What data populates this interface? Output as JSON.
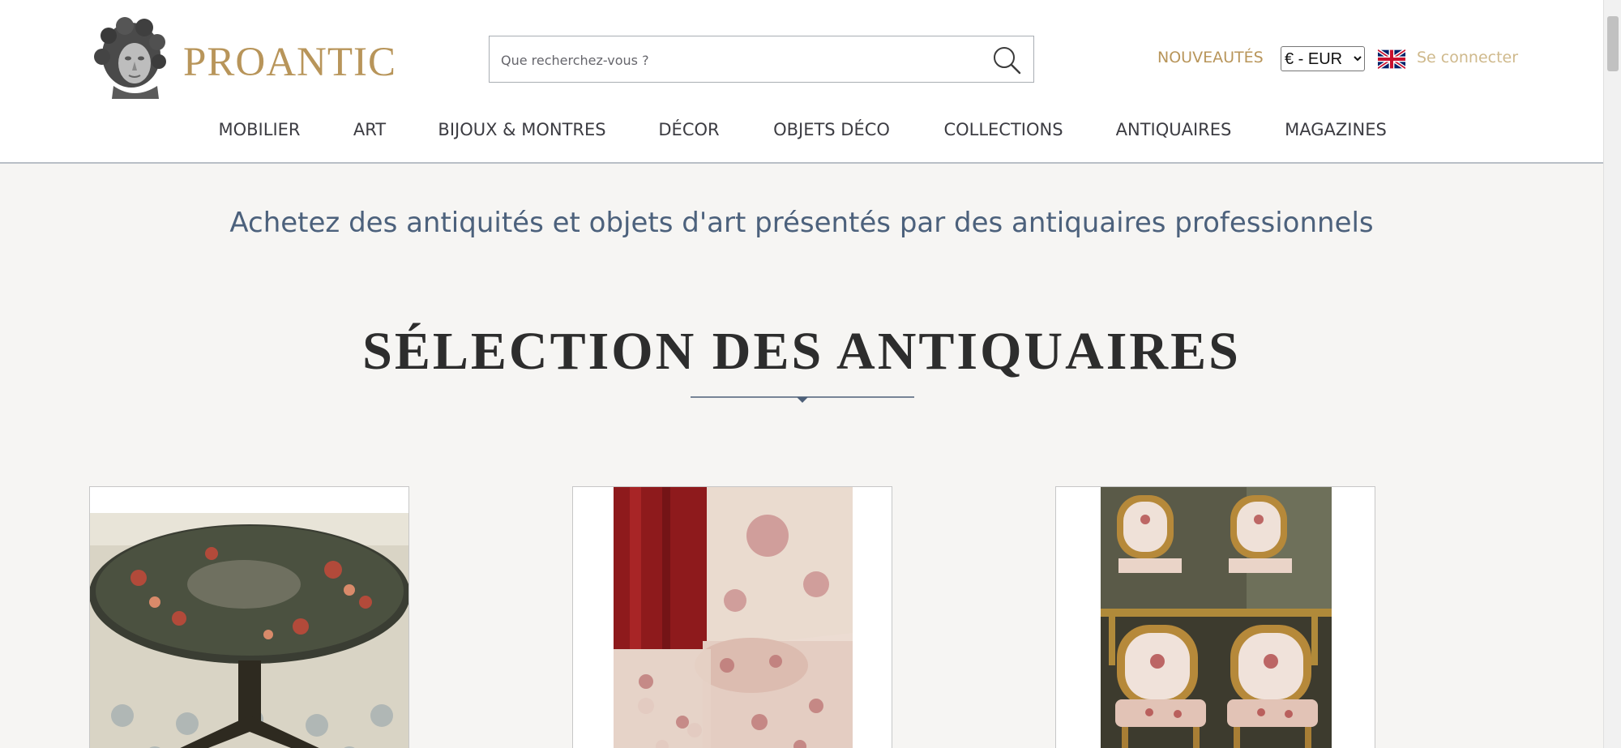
{
  "header": {
    "logo_text": "PROANTIC",
    "search": {
      "placeholder": "Que recherchez-vous ?",
      "value": "",
      "icon": "search-icon"
    },
    "new_label": "NOUVEAUTÉS",
    "currency": {
      "selected": "€ - EUR",
      "options": [
        "€ - EUR"
      ]
    },
    "language_flag": "uk-flag-icon",
    "login_label": "Se connecter"
  },
  "nav": {
    "items": [
      {
        "label": "MOBILIER"
      },
      {
        "label": "ART"
      },
      {
        "label": "BIJOUX & MONTRES"
      },
      {
        "label": "DÉCOR"
      },
      {
        "label": "OBJETS DÉCO"
      },
      {
        "label": "COLLECTIONS"
      },
      {
        "label": "ANTIQUAIRES"
      },
      {
        "label": "MAGAZINES"
      }
    ]
  },
  "main": {
    "tagline": "Achetez des antiquités et objets d'art présentés par des antiquaires professionnels",
    "section_title": "SÉLECTION DES ANTIQUAIRES"
  },
  "colors": {
    "brand_gold": "#b8955a",
    "login_gold": "#cfb98c",
    "tagline_blue": "#4c617c",
    "rule_blue": "#4d5f78",
    "page_bg": "#f6f5f3"
  }
}
